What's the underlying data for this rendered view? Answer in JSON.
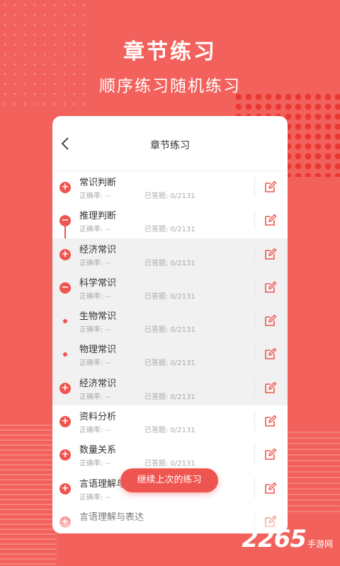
{
  "promo": {
    "title": "章节练习",
    "subtitle": "顺序练习随机练习"
  },
  "header": {
    "back_icon": "chevron-left-icon",
    "title": "章节练习"
  },
  "items": [
    {
      "name": "常识判断",
      "accuracy": "正确率: --",
      "answered": "已答题: 0/2131",
      "node": "+",
      "level": 1
    },
    {
      "name": "推理判断",
      "accuracy": "正确率: --",
      "answered": "已答题: 0/2131",
      "node": "−",
      "level": 1
    },
    {
      "name": "经济常识",
      "accuracy": "正确率: --",
      "answered": "已答题: 0/2131",
      "node": "+",
      "level": 2
    },
    {
      "name": "科学常识",
      "accuracy": "正确率: --",
      "answered": "已答题: 0/2131",
      "node": "−",
      "level": 2
    },
    {
      "name": "生物常识",
      "accuracy": "正确率: --",
      "answered": "已答题: 0/2131",
      "node": "",
      "level": 3
    },
    {
      "name": "物理常识",
      "accuracy": "正确率: --",
      "answered": "已答题: 0/2131",
      "node": "",
      "level": 3
    },
    {
      "name": "经济常识",
      "accuracy": "正确率: --",
      "answered": "已答题: 0/2131",
      "node": "+",
      "level": 2
    },
    {
      "name": "资料分析",
      "accuracy": "正确率: --",
      "answered": "已答题: 0/2131",
      "node": "+",
      "level": 1
    },
    {
      "name": "数量关系",
      "accuracy": "正确率: --",
      "answered": "已答题: 0/2131",
      "node": "+",
      "level": 1
    },
    {
      "name": "言语理解与表达",
      "accuracy": "正确率: --",
      "answered": "",
      "node": "+",
      "level": 1
    },
    {
      "name": "言语理解与表达",
      "accuracy": "",
      "answered": "",
      "node": "+",
      "level": 1
    }
  ],
  "continue_button": "继续上次的练习",
  "watermark": {
    "number": "2265",
    "site": "手游网"
  },
  "colors": {
    "accent": "#ef5550",
    "background": "#f2615b",
    "sub_row": "#f1f1f1"
  }
}
